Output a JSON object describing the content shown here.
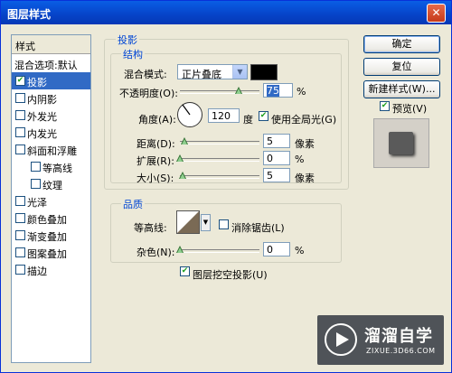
{
  "window": {
    "title": "图层样式",
    "close": "✕"
  },
  "left": {
    "header": "样式",
    "blend_options": "混合选项:默认",
    "items": [
      {
        "label": "投影",
        "checked": true
      },
      {
        "label": "内阴影",
        "checked": false
      },
      {
        "label": "外发光",
        "checked": false
      },
      {
        "label": "内发光",
        "checked": false
      },
      {
        "label": "斜面和浮雕",
        "checked": false
      },
      {
        "label": "等高线",
        "checked": false
      },
      {
        "label": "纹理",
        "checked": false
      },
      {
        "label": "光泽",
        "checked": false
      },
      {
        "label": "颜色叠加",
        "checked": false
      },
      {
        "label": "渐变叠加",
        "checked": false
      },
      {
        "label": "图案叠加",
        "checked": false
      },
      {
        "label": "描边",
        "checked": false
      }
    ]
  },
  "drop_shadow": {
    "section": "投影",
    "structure": "结构",
    "blend_mode_label": "混合模式:",
    "blend_mode_value": "正片叠底",
    "shadow_color": "#000000",
    "opacity_label": "不透明度(O):",
    "opacity_value": "75",
    "opacity_unit": "%",
    "angle_label": "角度(A):",
    "angle_value": "120",
    "angle_unit": "度",
    "global_light_label": "使用全局光(G)",
    "global_light_checked": true,
    "distance_label": "距离(D):",
    "distance_value": "5",
    "distance_unit": "像素",
    "spread_label": "扩展(R):",
    "spread_value": "0",
    "spread_unit": "%",
    "size_label": "大小(S):",
    "size_value": "5",
    "size_unit": "像素"
  },
  "quality": {
    "section": "品质",
    "contour_label": "等高线:",
    "antialias_label": "消除锯齿(L)",
    "antialias_checked": false,
    "noise_label": "杂色(N):",
    "noise_value": "0",
    "noise_unit": "%",
    "knockout_label": "图层挖空投影(U)",
    "knockout_checked": true
  },
  "buttons": {
    "ok": "确定",
    "reset": "复位",
    "new_style": "新建样式(W)...",
    "preview_label": "预览(V)",
    "preview_checked": true
  },
  "watermark": {
    "brand": "溜溜自学",
    "url": "ZIXUE.3D66.COM"
  }
}
